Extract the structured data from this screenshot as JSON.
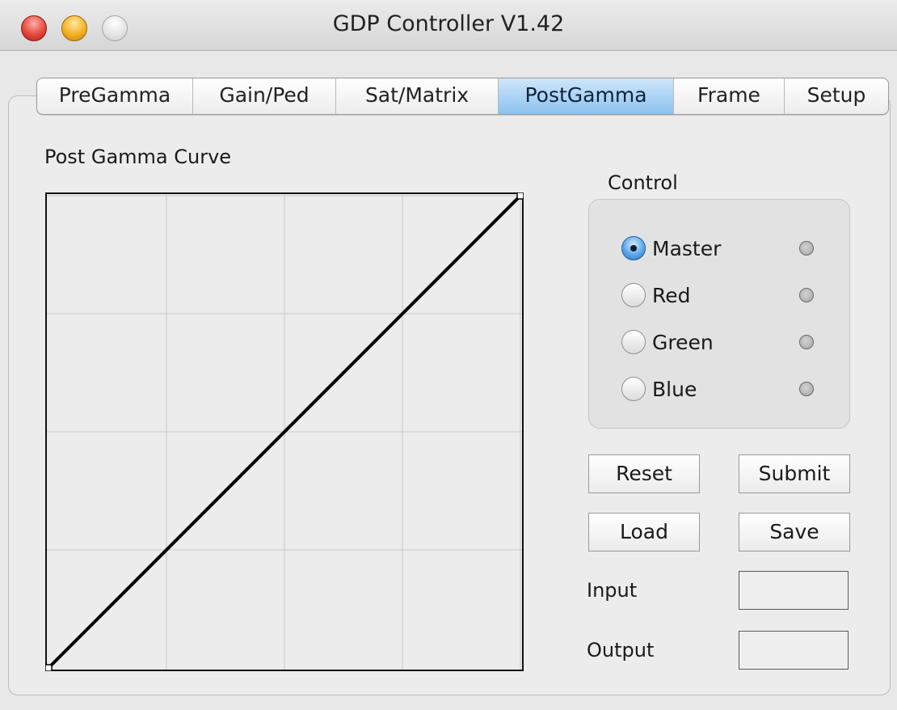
{
  "window": {
    "title": "GDP Controller V1.42"
  },
  "tabs": [
    {
      "label": "PreGamma",
      "active": false
    },
    {
      "label": "Gain/Ped",
      "active": false
    },
    {
      "label": "Sat/Matrix",
      "active": false
    },
    {
      "label": "PostGamma",
      "active": true
    },
    {
      "label": "Frame",
      "active": false
    },
    {
      "label": "Setup",
      "active": false
    }
  ],
  "curve": {
    "label": "Post Gamma Curve",
    "grid_divisions": 4,
    "points": [
      [
        0,
        0
      ],
      [
        1,
        1
      ]
    ]
  },
  "control": {
    "legend": "Control",
    "options": [
      {
        "label": "Master",
        "selected": true
      },
      {
        "label": "Red",
        "selected": false
      },
      {
        "label": "Green",
        "selected": false
      },
      {
        "label": "Blue",
        "selected": false
      }
    ]
  },
  "buttons": {
    "reset": "Reset",
    "submit": "Submit",
    "load": "Load",
    "save": "Save"
  },
  "fields": {
    "input": {
      "label": "Input",
      "value": ""
    },
    "output": {
      "label": "Output",
      "value": ""
    }
  }
}
